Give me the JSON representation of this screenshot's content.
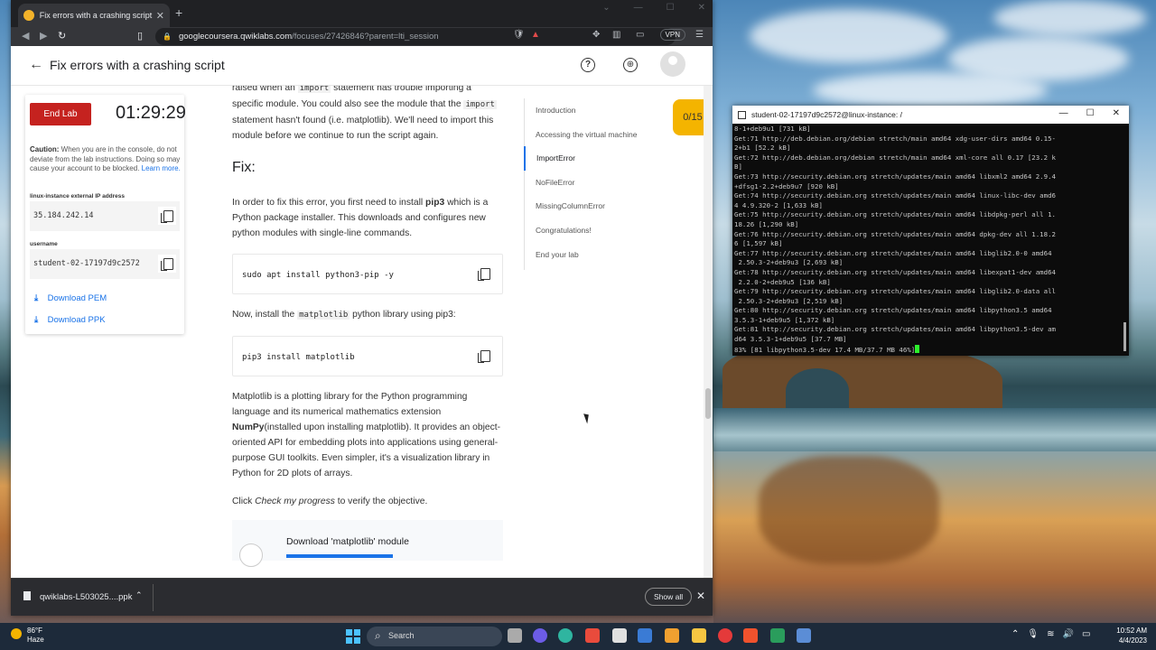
{
  "browser": {
    "tab_title": "Fix errors with a crashing script | Q",
    "url_host": "googlecoursera.qwiklabs.com",
    "url_path": "/focuses/27426846?parent=lti_session",
    "vpn_label": "VPN"
  },
  "app": {
    "page_title": "Fix errors with a crashing script"
  },
  "lab_card": {
    "end_lab_label": "End Lab",
    "timer": "01:29:29",
    "caution_bold": "Caution:",
    "caution_text": " When you are in the console, do not deviate from the lab instructions. Doing so may cause your account to be blocked.",
    "learn_more": "Learn more.",
    "ip_label": "linux-instance external IP address",
    "ip_value": "35.184.242.14",
    "username_label": "username",
    "username_value": "student-02-17197d9c2572",
    "download_pem": "Download PEM",
    "download_ppk": "Download PPK"
  },
  "main": {
    "para1_a": "raised when an ",
    "para1_code1": "import",
    "para1_b": " statement has trouble importing a specific module. You could also see the module that the ",
    "para1_code2": "import",
    "para1_c": " statement hasn't found (i.e. matplotlib). We'll need to import this module before we continue to run the script again.",
    "fix_heading": "Fix:",
    "para2_a": "In order to fix this error, you first need to install ",
    "para2_bold": "pip3",
    "para2_b": " which is a Python package installer. This downloads and configures new python modules with single-line commands.",
    "cmd1": "sudo apt install python3-pip -y",
    "para3_a": "Now, install the ",
    "para3_code": "matplotlib",
    "para3_b": " python library using pip3:",
    "cmd2": "pip3 install matplotlib",
    "para4_a": "Matplotlib is a plotting library for the Python programming language and its numerical mathematics extension ",
    "para4_bold": "NumPy",
    "para4_b": "(installed upon installing matplotlib). It provides an object-oriented API for embedding plots into applications using general-purpose GUI toolkits. Even simpler, it's a visualization library in Python for 2D plots of arrays.",
    "para5_a": "Click ",
    "para5_em": "Check my progress",
    "para5_b": " to verify the objective.",
    "progress_title": "Download 'matplotlib' module"
  },
  "toc": {
    "items": [
      "Introduction",
      "Accessing the virtual machine",
      "ImportError",
      "NoFileError",
      "MissingColumnError",
      "Congratulations!",
      "End your lab"
    ],
    "active_index": 2
  },
  "score": "0/15",
  "downloads": {
    "file_name": "qwiklabs-L503025....ppk",
    "show_all": "Show all"
  },
  "terminal": {
    "title": "student-02-17197d9c2572@linux-instance: /",
    "lines": [
      "8-1+deb9u1 [731 kB]",
      "Get:71 http://deb.debian.org/debian stretch/main amd64 xdg-user-dirs amd64 0.15-",
      "2+b1 [52.2 kB]",
      "Get:72 http://deb.debian.org/debian stretch/main amd64 xml-core all 0.17 [23.2 k",
      "B]",
      "Get:73 http://security.debian.org stretch/updates/main amd64 libxml2 amd64 2.9.4",
      "+dfsg1-2.2+deb9u7 [920 kB]",
      "Get:74 http://security.debian.org stretch/updates/main amd64 linux-libc-dev amd6",
      "4 4.9.320-2 [1,633 kB]",
      "Get:75 http://security.debian.org stretch/updates/main amd64 libdpkg-perl all 1.",
      "18.26 [1,290 kB]",
      "Get:76 http://security.debian.org stretch/updates/main amd64 dpkg-dev all 1.18.2",
      "6 [1,597 kB]",
      "Get:77 http://security.debian.org stretch/updates/main amd64 libglib2.0-0 amd64",
      " 2.50.3-2+deb9u3 [2,693 kB]",
      "Get:78 http://security.debian.org stretch/updates/main amd64 libexpat1-dev amd64",
      " 2.2.0-2+deb9u5 [136 kB]",
      "Get:79 http://security.debian.org stretch/updates/main amd64 libglib2.0-data all",
      " 2.50.3-2+deb9u3 [2,519 kB]",
      "Get:80 http://security.debian.org stretch/updates/main amd64 libpython3.5 amd64",
      "3.5.3-1+deb9u5 [1,372 kB]",
      "Get:81 http://security.debian.org stretch/updates/main amd64 libpython3.5-dev am",
      "d64 3.5.3-1+deb9u5 [37.7 MB]"
    ],
    "last_line": "83% [81 libpython3.5-dev 17.4 MB/37.7 MB 46%]"
  },
  "taskbar": {
    "temperature": "86°F",
    "weather": "Haze",
    "search_label": "Search",
    "time": "10:52 AM",
    "date": "4/4/2023"
  },
  "colors": {
    "accent": "#1a73e8",
    "end_lab": "#c5221f",
    "score_badge": "#f4b400"
  }
}
